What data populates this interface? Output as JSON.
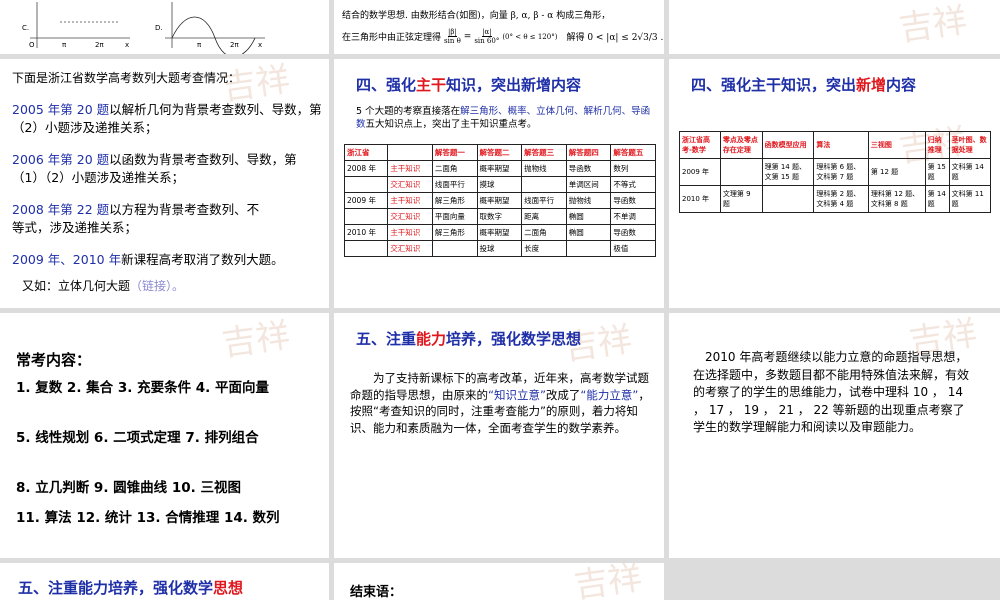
{
  "slide_b": {
    "line1": "结合的数学思想. 由数形结合(如图)，向量 β, α, β - α 构成三角形，",
    "line2_a": "在三角形中由正弦定理得",
    "line2_frac1_num": "|β|",
    "line2_frac1_den": "sin θ",
    "line2_eq": "=",
    "line2_frac2_num": "|α|",
    "line2_frac2_den": "sin 60°",
    "line2_cond": "(0° < θ ≤ 120°)",
    "line2_result": "解得 0 < |α| ≤ 2√3/3 ."
  },
  "slide_d": {
    "intro": "下面是浙江省数学高考数列大题考查情况：",
    "p1_year": "2005 年第 20 题",
    "p1_text": "以解析几何为背景考查数列、导数，第（2）小题涉及递推关系；",
    "p2_year": "2006 年第 20 题",
    "p2_text": "以函数为背景考查数列、导数，第（1）（2）小题涉及递推关系；",
    "p3_year": "2008 年第 22 题",
    "p3_text": "以方程为背景考查数列、不等式，涉及递推关系；",
    "p4_year": "2009 年、2010 年",
    "p4_text": "新课程高考取消了数列大题。",
    "p5_text": "又如：立体几何大题",
    "p5_link": "（链接）。"
  },
  "slide_e": {
    "title_a": "四、强化",
    "title_red": "主干",
    "title_b": "知识，突出新增内容",
    "desc_a": "5 个大题的考察直接落在",
    "desc_hl": "解三角形、概率、立体几何、解析几何、导函数",
    "desc_b": "五大知识点上，突出了主干知识重点考。",
    "header": [
      "浙江省",
      "",
      "解答题一",
      "解答题二",
      "解答题三",
      "解答题四",
      "解答题五"
    ],
    "rows": [
      [
        "2008 年",
        "主干知识",
        "二面角",
        "概率期望",
        "抛物线",
        "导函数",
        "数列"
      ],
      [
        "",
        "交汇知识",
        "线面平行",
        "摸球",
        "",
        "单调区间",
        "不等式"
      ],
      [
        "2009 年",
        "主干知识",
        "解三角形",
        "概率期望",
        "线面平行",
        "抛物线",
        "导函数"
      ],
      [
        "",
        "交汇知识",
        "平面向量",
        "取数字",
        "距离",
        "椭圆",
        "不单调"
      ],
      [
        "2010 年",
        "主干知识",
        "解三角形",
        "概率期望",
        "二面角",
        "椭圆",
        "导函数"
      ],
      [
        "",
        "交汇知识",
        "",
        "投球",
        "长度",
        "",
        "极值"
      ]
    ]
  },
  "slide_f": {
    "title_a": "四、强化主干知识，突出",
    "title_red": "新增",
    "title_b": "内容",
    "header": [
      "浙江省高考-数学",
      "零点及零点存在定理",
      "函数模型应用",
      "算法",
      "三视图",
      "归纳推理",
      "茎叶图、数据处理"
    ],
    "rows": [
      [
        "2009 年",
        "",
        "理第 14 题、文第 15 题",
        "理科第 6 题、文科第 7 题",
        "第 12 题",
        "第 15 题",
        "文科第 14 题"
      ],
      [
        "2010 年",
        "文理第 9 题",
        "",
        "理科第 2 题、文科第 4 题",
        "理科第 12 题、文科第 8 题",
        "第 14 题",
        "文科第 11 题"
      ]
    ]
  },
  "slide_g": {
    "title": "常考内容：",
    "lines": [
      "1. 复数  2. 集合  3. 充要条件  4. 平面向量",
      "5. 线性规划  6. 二项式定理  7. 排列组合",
      "8. 立几判断  9. 圆锥曲线   10. 三视图",
      "11. 算法  12. 统计  13. 合情推理 14. 数列"
    ]
  },
  "slide_h": {
    "title_a": "五、注重",
    "title_red": "能力",
    "title_b": "培养，强化数学思想",
    "p_a": "为了支持新课标下的高考改革，近年来，高考数学试题命题的指导思想，由原来的",
    "p_hl1": "“知识立意”",
    "p_b": "改成了",
    "p_hl2": "“能力立意”",
    "p_c": "，按照“考查知识的同时，注重考查能力”的原则，着力将知识、能力和素质融为一体，全面考查学生的数学素养。"
  },
  "slide_i": {
    "text": "2010 年高考题继续以能力立意的命题指导思想，在选择题中，多数题目都不能用特殊值法来解，有效的考察了的学生的思维能力，试卷中理科 10 ， 14 ， 17 ， 19 ， 21 ， 22 等新题的出现重点考察了学生的数学理解能力和阅读以及审题能力。"
  },
  "slide_j": {
    "title_a": "五、注重能力培养，强化数学",
    "title_red": "思想"
  },
  "slide_k": {
    "title": "结束语："
  },
  "slide_a": {
    "lbl_c": "C.",
    "lbl_d": "D.",
    "ticks": [
      "π",
      "2π",
      "x",
      "O"
    ]
  },
  "watermark": "吉祥"
}
